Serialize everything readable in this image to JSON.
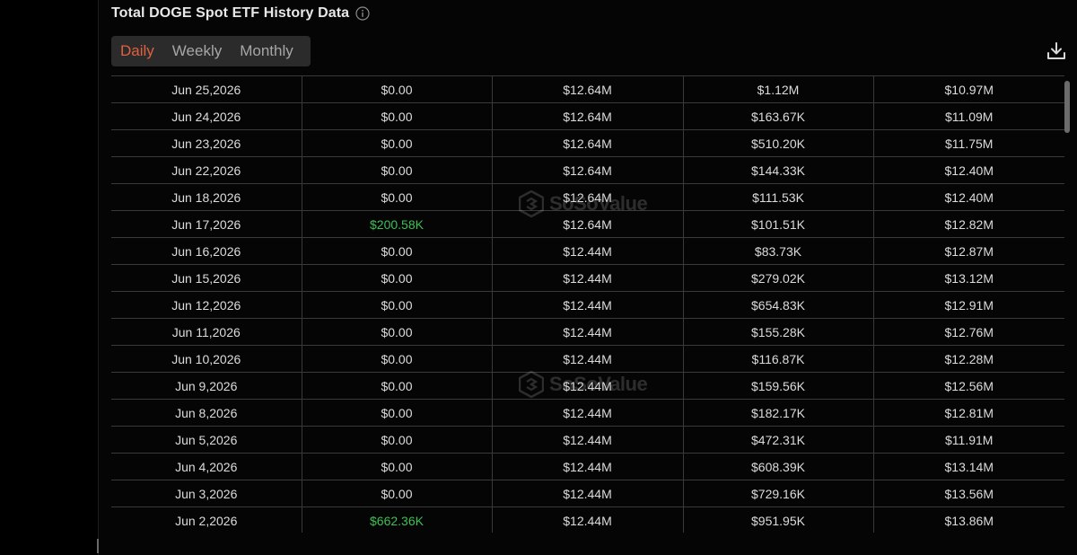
{
  "title": "Total DOGE Spot ETF History Data",
  "tabs": [
    {
      "label": "Daily",
      "active": true
    },
    {
      "label": "Weekly",
      "active": false
    },
    {
      "label": "Monthly",
      "active": false
    }
  ],
  "watermark": "SoSoValue",
  "accent_color": "#e0603f",
  "positive_color": "#3fbf54",
  "rows": [
    {
      "date": "Jun 25,2026",
      "inflow": "$0.00",
      "cumulative": "$12.64M",
      "value_traded": "$1.12M",
      "net_assets": "$10.97M",
      "positive": false
    },
    {
      "date": "Jun 24,2026",
      "inflow": "$0.00",
      "cumulative": "$12.64M",
      "value_traded": "$163.67K",
      "net_assets": "$11.09M",
      "positive": false
    },
    {
      "date": "Jun 23,2026",
      "inflow": "$0.00",
      "cumulative": "$12.64M",
      "value_traded": "$510.20K",
      "net_assets": "$11.75M",
      "positive": false
    },
    {
      "date": "Jun 22,2026",
      "inflow": "$0.00",
      "cumulative": "$12.64M",
      "value_traded": "$144.33K",
      "net_assets": "$12.40M",
      "positive": false
    },
    {
      "date": "Jun 18,2026",
      "inflow": "$0.00",
      "cumulative": "$12.64M",
      "value_traded": "$111.53K",
      "net_assets": "$12.40M",
      "positive": false
    },
    {
      "date": "Jun 17,2026",
      "inflow": "$200.58K",
      "cumulative": "$12.64M",
      "value_traded": "$101.51K",
      "net_assets": "$12.82M",
      "positive": true
    },
    {
      "date": "Jun 16,2026",
      "inflow": "$0.00",
      "cumulative": "$12.44M",
      "value_traded": "$83.73K",
      "net_assets": "$12.87M",
      "positive": false
    },
    {
      "date": "Jun 15,2026",
      "inflow": "$0.00",
      "cumulative": "$12.44M",
      "value_traded": "$279.02K",
      "net_assets": "$13.12M",
      "positive": false
    },
    {
      "date": "Jun 12,2026",
      "inflow": "$0.00",
      "cumulative": "$12.44M",
      "value_traded": "$654.83K",
      "net_assets": "$12.91M",
      "positive": false
    },
    {
      "date": "Jun 11,2026",
      "inflow": "$0.00",
      "cumulative": "$12.44M",
      "value_traded": "$155.28K",
      "net_assets": "$12.76M",
      "positive": false
    },
    {
      "date": "Jun 10,2026",
      "inflow": "$0.00",
      "cumulative": "$12.44M",
      "value_traded": "$116.87K",
      "net_assets": "$12.28M",
      "positive": false
    },
    {
      "date": "Jun 9,2026",
      "inflow": "$0.00",
      "cumulative": "$12.44M",
      "value_traded": "$159.56K",
      "net_assets": "$12.56M",
      "positive": false
    },
    {
      "date": "Jun 8,2026",
      "inflow": "$0.00",
      "cumulative": "$12.44M",
      "value_traded": "$182.17K",
      "net_assets": "$12.81M",
      "positive": false
    },
    {
      "date": "Jun 5,2026",
      "inflow": "$0.00",
      "cumulative": "$12.44M",
      "value_traded": "$472.31K",
      "net_assets": "$11.91M",
      "positive": false
    },
    {
      "date": "Jun 4,2026",
      "inflow": "$0.00",
      "cumulative": "$12.44M",
      "value_traded": "$608.39K",
      "net_assets": "$13.14M",
      "positive": false
    },
    {
      "date": "Jun 3,2026",
      "inflow": "$0.00",
      "cumulative": "$12.44M",
      "value_traded": "$729.16K",
      "net_assets": "$13.56M",
      "positive": false
    },
    {
      "date": "Jun 2,2026",
      "inflow": "$662.36K",
      "cumulative": "$12.44M",
      "value_traded": "$951.95K",
      "net_assets": "$13.86M",
      "positive": true
    }
  ]
}
